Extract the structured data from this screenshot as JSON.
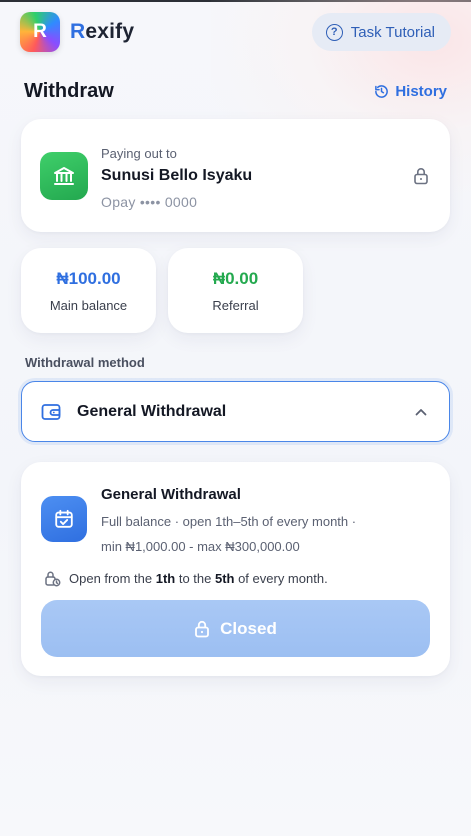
{
  "brand": {
    "logo_letter": "R",
    "name_first": "R",
    "name_rest": "exify"
  },
  "header": {
    "tutorial_label": "Task Tutorial"
  },
  "page": {
    "title": "Withdraw",
    "history_label": "History"
  },
  "payout": {
    "label": "Paying out to",
    "name": "Sunusi Bello Isyaku",
    "account": "Opay •••• 0000"
  },
  "balances": [
    {
      "amount": "₦100.00",
      "caption": "Main balance"
    },
    {
      "amount": "₦0.00",
      "caption": "Referral"
    }
  ],
  "method": {
    "section_label": "Withdrawal method",
    "selected": "General Withdrawal"
  },
  "method_card": {
    "title": "General Withdrawal",
    "desc_line1": "Full balance · open 1th–5th of every month ·",
    "desc_line2": "min ₦1,000.00 - max ₦300,000.00",
    "note_prefix": "Open from the ",
    "note_start": "1th",
    "note_middle": " to the ",
    "note_end": "5th",
    "note_suffix": " of every month.",
    "button_label": "Closed"
  },
  "colors": {
    "accent_blue": "#2f6fe0",
    "success_green": "#24a94f",
    "closed_button": "#a9c8f5"
  },
  "icons": [
    "question-circle-icon",
    "history-icon",
    "bank-icon",
    "lock-icon",
    "wallet-icon",
    "chevron-up-icon",
    "calendar-check-icon",
    "clock-lock-icon"
  ]
}
